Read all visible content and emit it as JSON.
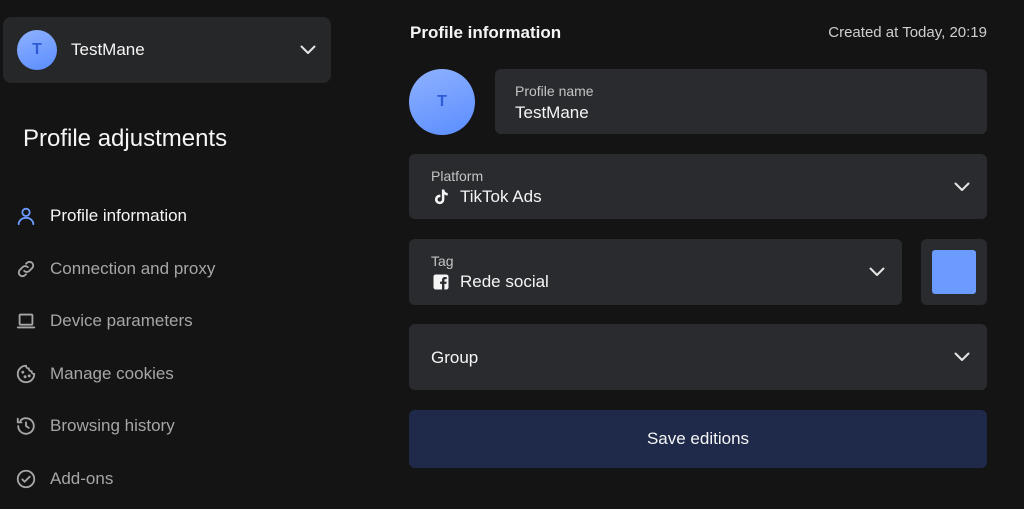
{
  "profile_selector": {
    "avatar_initial": "T",
    "name": "TestMane"
  },
  "sidebar": {
    "title": "Profile adjustments",
    "items": [
      {
        "label": "Profile information",
        "icon": "user-icon",
        "active": true
      },
      {
        "label": "Connection and proxy",
        "icon": "link-icon",
        "active": false
      },
      {
        "label": "Device parameters",
        "icon": "laptop-icon",
        "active": false
      },
      {
        "label": "Manage cookies",
        "icon": "cookie-icon",
        "active": false
      },
      {
        "label": "Browsing history",
        "icon": "history-icon",
        "active": false
      },
      {
        "label": "Add-ons",
        "icon": "check-circle-icon",
        "active": false
      }
    ]
  },
  "main": {
    "title": "Profile information",
    "created": "Created at Today, 20:19",
    "avatar_initial": "T",
    "profile_name": {
      "label": "Profile name",
      "value": "TestMane"
    },
    "platform": {
      "label": "Platform",
      "value": "TikTok Ads",
      "icon": "tiktok-icon"
    },
    "tag": {
      "label": "Tag",
      "value": "Rede social",
      "icon": "facebook-icon"
    },
    "tag_color": "#6b9bff",
    "group": {
      "placeholder": "Group"
    },
    "save_label": "Save editions"
  },
  "colors": {
    "background": "#141414",
    "panel": "#2a2b2e",
    "accent": "#6b9bff",
    "save_button": "#1f2a4a"
  }
}
